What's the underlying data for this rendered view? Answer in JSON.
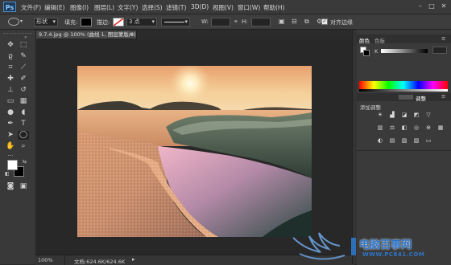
{
  "app": {
    "logo": "Ps"
  },
  "menu": {
    "items": [
      "文件(F)",
      "编辑(E)",
      "图像(I)",
      "图层(L)",
      "文字(Y)",
      "选择(S)",
      "滤镜(T)",
      "3D(D)",
      "视图(V)",
      "窗口(W)",
      "帮助(H)"
    ]
  },
  "window_controls": {
    "minimize": "–",
    "maximize": "□",
    "close": "✕"
  },
  "options": {
    "shape_mode": "形状",
    "fill_label": "填充:",
    "stroke_label": "描边:",
    "stroke_width": "3 点",
    "w_label": "W:",
    "h_label": "H:",
    "align_edges_label": "对齐边缘",
    "align_edges_checked": true
  },
  "document": {
    "tab_title": "9.7.4.jpg @ 100% (曲线 1, 图层蒙版/8) *",
    "close": "×"
  },
  "status": {
    "zoom": "100%",
    "doc_info": "文档:624.6K/624.6K"
  },
  "panels": {
    "color_tab": "颜色",
    "swatches_tab": "色板",
    "k_label": "K",
    "k_value": "",
    "adjustments_tab": "调整",
    "add_adjustment_label": "添加调整"
  },
  "watermark": {
    "site_name": "电脑百事网",
    "url": "WWW.PC841.COM"
  },
  "colors": {
    "accent_blue": "#2f76c8",
    "ps_logo_bg": "#1d3b5c"
  }
}
